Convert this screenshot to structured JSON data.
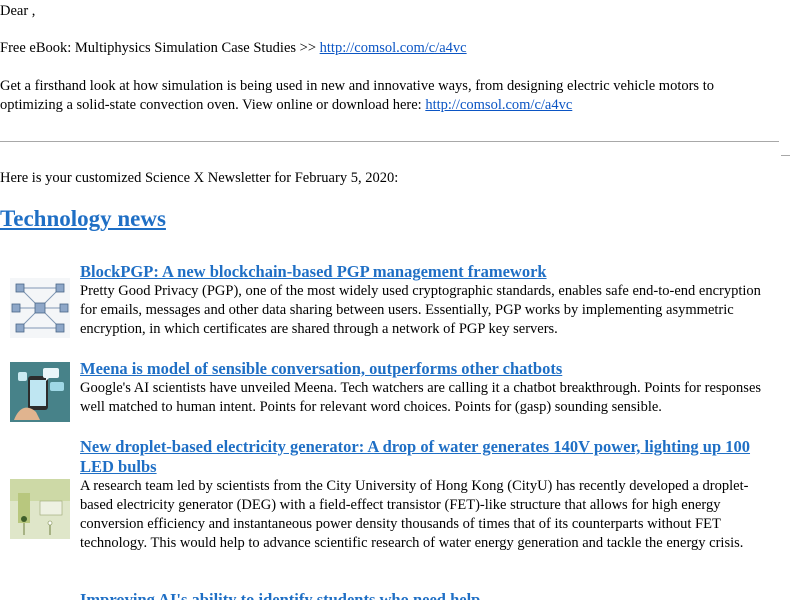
{
  "email": {
    "greeting": "Dear ,",
    "promo": {
      "text": "Free eBook: Multiphysics Simulation Case Studies >> ",
      "link": "http://comsol.com/c/a4vc"
    },
    "promo_body": {
      "line1": "Get a firsthand look at how simulation is being used in new and innovative ways, from designing electric vehicle motors to",
      "line2": "optimizing a solid-state convection oven. View online or download here: ",
      "link": "http://comsol.com/c/a4vc"
    },
    "newsletter_intro": "Here is your customized Science X Newsletter for February 5, 2020:",
    "section_heading": "Technology news",
    "articles": [
      {
        "title": "BlockPGP: A new blockchain-based PGP management framework",
        "summary": "Pretty Good Privacy (PGP), one of the most widely used cryptographic standards, enables safe end-to-end encryption for emails, messages and other data sharing between users. Essentially, PGP works by implementing asymmetric encryption, in which certificates are shared through a network of PGP key servers."
      },
      {
        "title": "Meena is model of sensible conversation, outperforms other chatbots",
        "summary": "Google's AI scientists have unveiled Meena. Tech watchers are calling it a chatbot breakthrough. Points for responses well matched to human intent. Points for relevant word choices. Points for (gasp) sounding sensible."
      },
      {
        "title": "New droplet-based electricity generator: A drop of water generates 140V power, lighting up 100 LED bulbs",
        "summary": "A research team led by scientists from the City University of Hong Kong (CityU) has recently developed a droplet-based electricity generator (DEG) with a field-effect transistor (FET)-like structure that allows for high energy conversion efficiency and instantaneous power density thousands of times that of its counterparts without FET technology. This would help to advance scientific research of water energy generation and tackle the energy crisis."
      },
      {
        "title": "Improving AI's ability to identify students who need help"
      }
    ]
  },
  "colors": {
    "link": "#0b55c4",
    "heading_link": "#1f6fc5",
    "divider": "#a8a8a8"
  }
}
